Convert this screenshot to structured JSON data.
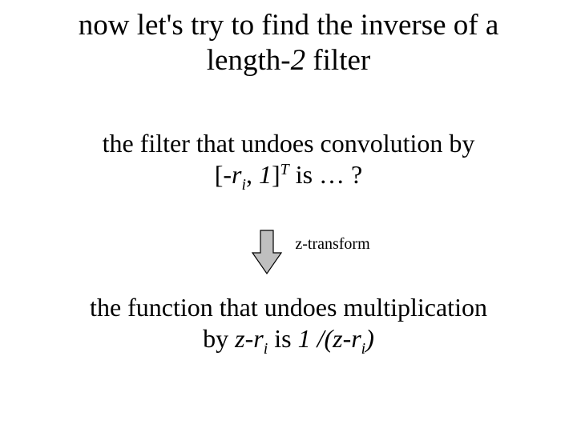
{
  "title": {
    "line1_pre": "now let's try to find the inverse of a",
    "line2_pre": "length-",
    "line2_two": "2",
    "line2_post": " filter"
  },
  "para2": {
    "line1": "the filter that undoes convolution by",
    "line2_lb": "[-",
    "line2_r": "r",
    "line2_sub": "i",
    "line2_comma": ",",
    "line2_sp1": " ",
    "line2_one": "1",
    "line2_rb": "]",
    "line2_T": "T",
    "line2_post": " is … ?"
  },
  "arrow_label": "z-transform",
  "para3": {
    "line1": "the function that undoes multiplication",
    "line2_by": "by ",
    "line2_lhs_z": "z-r",
    "line2_lhs_i": "i",
    "line2_is": " is",
    "line2_sp": " ",
    "line2_one": "1",
    "line2_div": " /(",
    "line2_rhs_z": "z-r",
    "line2_rhs_i": "i",
    "line2_close": ")"
  },
  "arrow": {
    "fill": "#bfbfbf",
    "stroke": "#000000"
  }
}
